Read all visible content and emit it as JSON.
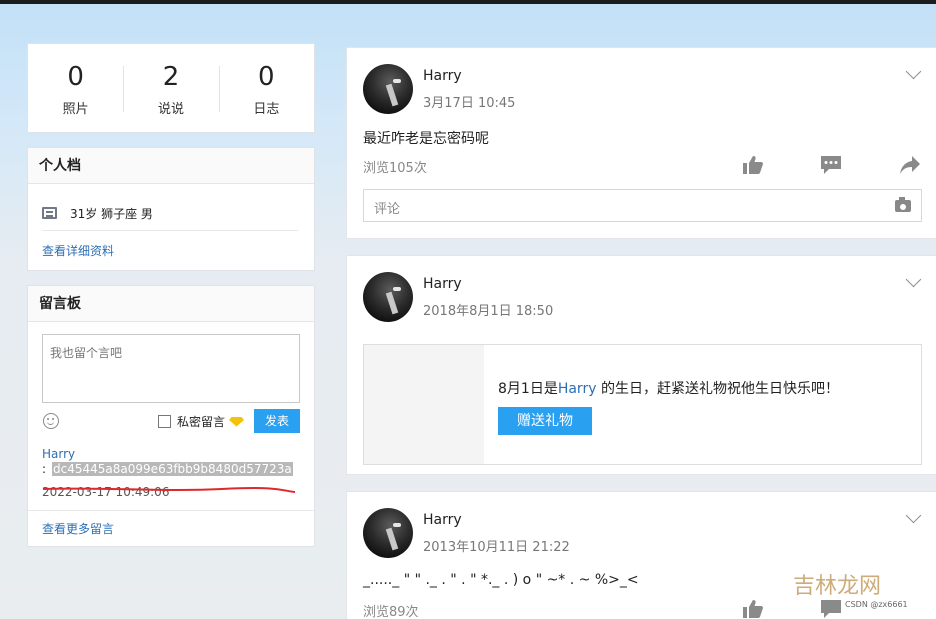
{
  "stats": [
    {
      "value": "0",
      "label": "照片"
    },
    {
      "value": "2",
      "label": "说说"
    },
    {
      "value": "0",
      "label": "日志"
    }
  ],
  "profile": {
    "title": "个人档",
    "info": "31岁  狮子座 男",
    "detail_link": "查看详细资料"
  },
  "board": {
    "title": "留言板",
    "placeholder": "我也留个言吧",
    "private_label": "私密留言",
    "send_label": "发表",
    "comment": {
      "author": "Harry",
      "prefix": ":",
      "text": "dc45445a8a099e63fbb9b8480d57723a",
      "time": "2022-03-17 10:49:06"
    },
    "more_link": "查看更多留言"
  },
  "feed": [
    {
      "name": "Harry",
      "time": "3月17日 10:45",
      "text": "最近咋老是忘密码呢",
      "views": "浏览105次",
      "comment_placeholder": "评论"
    },
    {
      "name": "Harry",
      "time": "2018年8月1日 18:50",
      "birthday_pre": "8月1日是",
      "birthday_name": "Harry",
      "birthday_post": " 的生日，赶紧送礼物祝他生日快乐吧！",
      "gift_button": "赠送礼物"
    },
    {
      "name": "Harry",
      "time": "2013年10月11日 21:22",
      "text": "_....._ \" \" ._ . \" . \" *._ . ) o \" ~* . ~ %>_<",
      "views": "浏览89次"
    }
  ],
  "watermark": "吉林龙网",
  "credit": "CSDN @zx6661",
  "colors": {
    "accent": "#2aa0f0",
    "link": "#2d6fb4",
    "underline": "#e0282a"
  }
}
